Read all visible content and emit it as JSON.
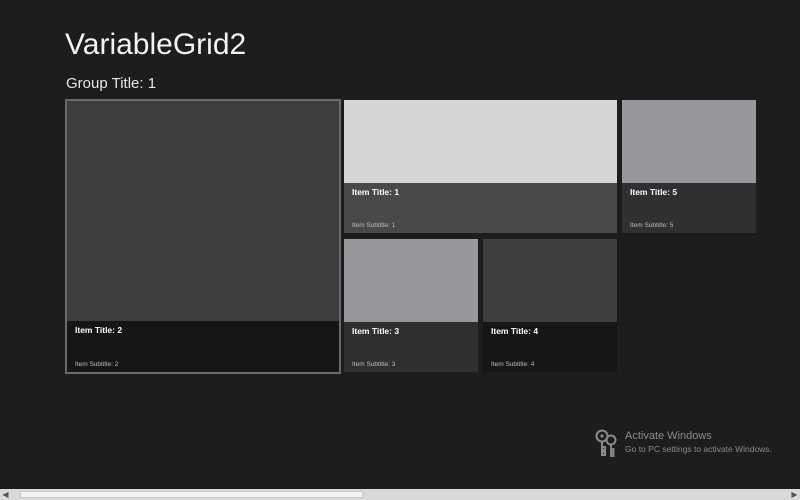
{
  "app": {
    "title": "VariableGrid2"
  },
  "group": {
    "title": "Group Title: 1"
  },
  "items": [
    {
      "id": "2",
      "title": "Item Title: 2",
      "subtitle": "Item Subtitle: 2"
    },
    {
      "id": "1",
      "title": "Item Title: 1",
      "subtitle": "Item Subtitle: 1"
    },
    {
      "id": "5",
      "title": "Item Title: 5",
      "subtitle": "Item Subtitle: 5"
    },
    {
      "id": "3",
      "title": "Item Title: 3",
      "subtitle": "Item Subtitle: 3"
    },
    {
      "id": "4",
      "title": "Item Title: 4",
      "subtitle": "Item Subtitle: 4"
    }
  ],
  "watermark": {
    "line1": "Activate Windows",
    "line2": "Go to PC settings to activate Windows.",
    "icon": "keys-icon"
  },
  "scrollbar": {
    "left_arrow": "◀",
    "right_arrow": "▶"
  },
  "colors": {
    "background": "#1d1d1d",
    "tile_light": "#d4d5d7",
    "tile_medium": "#97989b",
    "tile_dark": "#3e3e40",
    "selected_border": "#6a6a6a"
  }
}
